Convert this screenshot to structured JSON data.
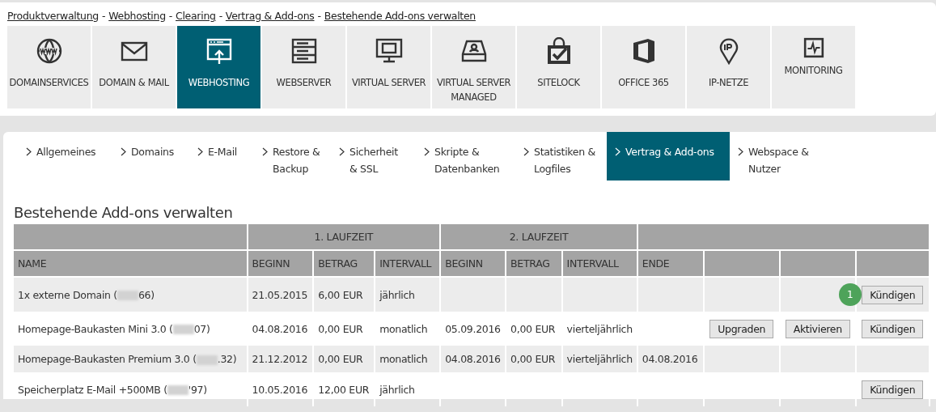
{
  "breadcrumb": [
    {
      "label": "Produktverwaltung"
    },
    {
      "label": "Webhosting"
    },
    {
      "label": "Clearing"
    },
    {
      "label": "Vertrag & Add-ons"
    },
    {
      "label": "Bestehende Add-ons verwalten"
    }
  ],
  "breadcrumb_separator": "-",
  "products": [
    {
      "label": "DOMAINSERVICES",
      "selected": false
    },
    {
      "label": "DOMAIN & MAIL",
      "selected": false
    },
    {
      "label": "WEBHOSTING",
      "selected": true
    },
    {
      "label": "WEBSERVER",
      "selected": false
    },
    {
      "label": "VIRTUAL SERVER",
      "selected": false
    },
    {
      "label": "VIRTUAL SERVER MANAGED",
      "selected": false
    },
    {
      "label": "SITELOCK",
      "selected": false
    },
    {
      "label": "OFFICE 365",
      "selected": false
    },
    {
      "label": "IP-NETZE",
      "selected": false
    },
    {
      "label": "MONITORING",
      "selected": false
    }
  ],
  "tabs": [
    {
      "label": "Allgemeines",
      "selected": false
    },
    {
      "label": "Domains",
      "selected": false
    },
    {
      "label": "E-Mail",
      "selected": false
    },
    {
      "label": "Restore & Backup",
      "selected": false
    },
    {
      "label": "Sicherheit & SSL",
      "selected": false
    },
    {
      "label": "Skripte & Datenbanken",
      "selected": false
    },
    {
      "label": "Statistiken & Logfiles",
      "selected": false
    },
    {
      "label": "Vertrag & Add-ons",
      "selected": true
    },
    {
      "label": "Webspace & Nutzer",
      "selected": false
    }
  ],
  "section_title": "Bestehende Add-ons verwalten",
  "table": {
    "group_headers": [
      "1. LAUFZEIT",
      "2. LAUFZEIT"
    ],
    "columns": [
      "NAME",
      "BEGINN",
      "BETRAG",
      "INTERVALL",
      "BEGINN",
      "BETRAG",
      "INTERVALL",
      "ENDE"
    ],
    "rows": [
      {
        "cells": [
          {
            "start": "1x externe Domain (",
            "end": "66)"
          },
          "21.05.2015",
          "6,00 EUR",
          "jährlich",
          null,
          null,
          null,
          null
        ],
        "actions": [
          {
            "kind": "cancel",
            "label": "Kündigen",
            "badge": "1"
          }
        ]
      },
      {
        "cells": [
          {
            "start": "Homepage-Baukasten Mini 3.0 (",
            "end": "07)"
          },
          "04.08.2016",
          "0,00 EUR",
          "monatlich",
          "05.09.2016",
          "0,00 EUR",
          "vierteljährlich",
          null
        ],
        "actions": [
          {
            "kind": "upgrade",
            "label": "Upgraden"
          },
          {
            "kind": "activate",
            "label": "Aktivieren"
          },
          {
            "kind": "cancel",
            "label": "Kündigen"
          }
        ]
      },
      {
        "cells": [
          {
            "start": "Homepage-Baukasten Premium 3.0 (",
            "end": ".32)"
          },
          "21.12.2012",
          "0,00 EUR",
          "monatlich",
          "04.08.2016",
          "0,00 EUR",
          "vierteljährlich",
          "04.08.2016"
        ]
      },
      {
        "cells": [
          {
            "start": "Speicherplatz E-Mail +500MB (",
            "end": "'97)"
          },
          "10.05.2016",
          "12,00 EUR",
          "jährlich",
          null,
          null,
          null,
          null
        ],
        "actions": [
          {
            "kind": "cancel",
            "label": "Kündigen"
          }
        ]
      }
    ]
  }
}
